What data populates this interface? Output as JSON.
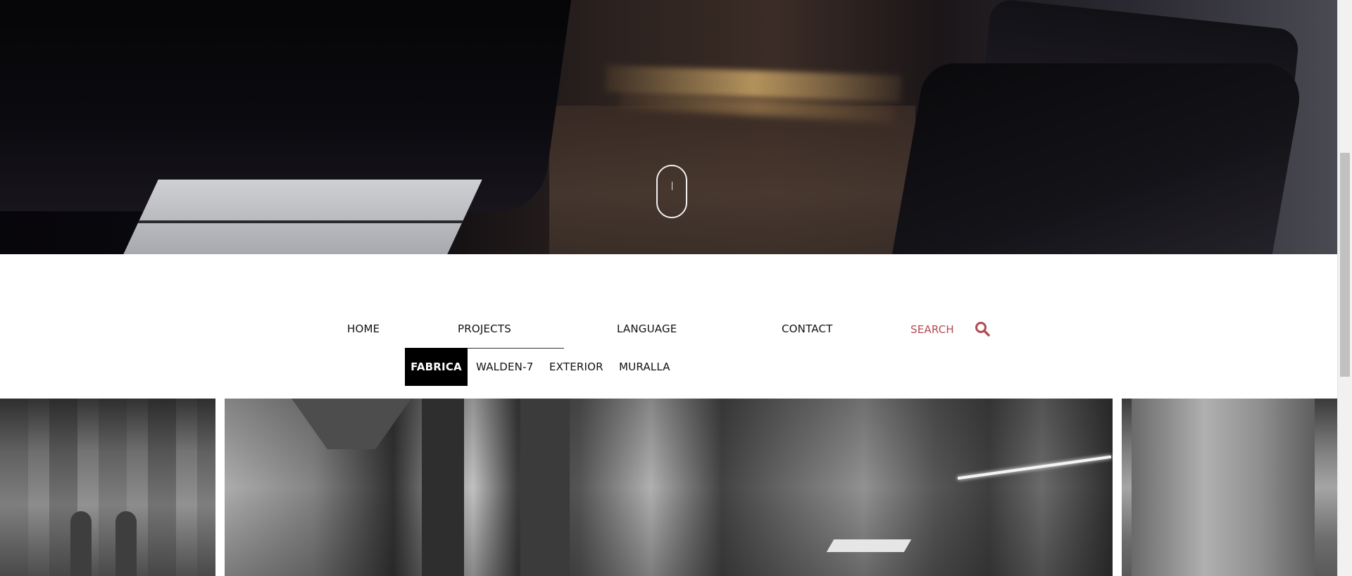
{
  "nav": {
    "home": "HOME",
    "projects": "PROJECTS",
    "language": "LANGUAGE",
    "contact": "CONTACT",
    "search": "SEARCH",
    "search_icon": "search-icon",
    "search_color": "#b34a52"
  },
  "subnav": {
    "items": [
      "FABRICA",
      "WALDEN-7",
      "EXTERIOR",
      "MURALLA"
    ],
    "active": "FABRICA"
  },
  "hero": {
    "scroll_icon": "scroll-mouse-icon"
  }
}
